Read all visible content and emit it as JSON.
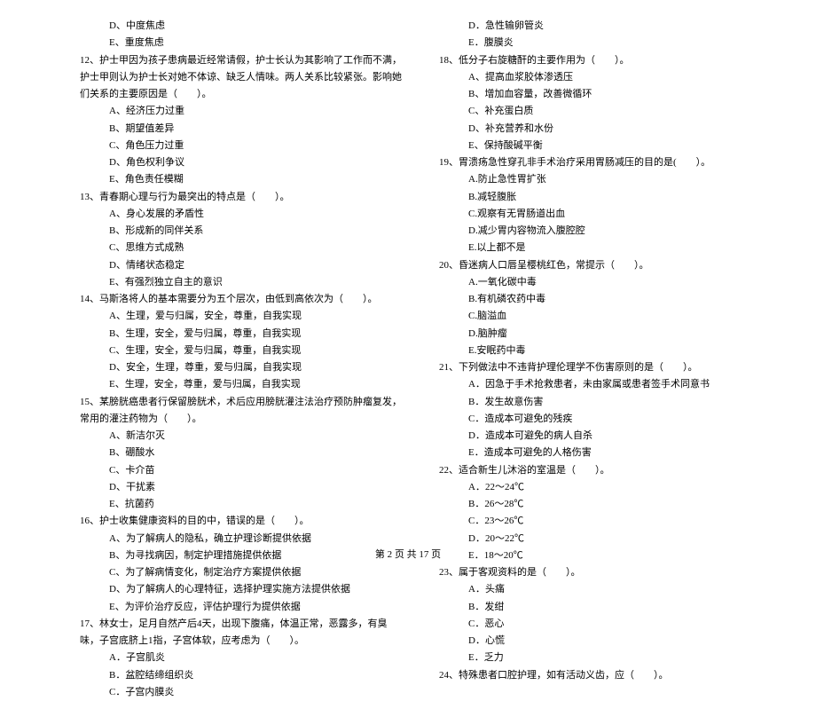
{
  "left": {
    "q11_opts": [
      "D、中度焦虑",
      "E、重度焦虑"
    ],
    "q12_stem": "12、护士甲因为孩子患病最近经常请假，护士长认为其影响了工作而不满，护士甲则认为护士长对她不体谅、缺乏人情味。两人关系比较紧张。影响她们关系的主要原因是（　　）。",
    "q12_opts": [
      "A、经济压力过重",
      "B、期望值差异",
      "C、角色压力过重",
      "D、角色权利争议",
      "E、角色责任模糊"
    ],
    "q13_stem": "13、青春期心理与行为最突出的特点是（　　）。",
    "q13_opts": [
      "A、身心发展的矛盾性",
      "B、形成新的同伴关系",
      "C、思维方式成熟",
      "D、情绪状态稳定",
      "E、有强烈独立自主的意识"
    ],
    "q14_stem": "14、马斯洛将人的基本需要分为五个层次，由低到高依次为（　　）。",
    "q14_opts": [
      "A、生理，爱与归属，安全，尊重，自我实现",
      "B、生理，安全，爱与归属，尊重，自我实现",
      "C、生理，安全，爱与归属，尊重，自我实现",
      "D、安全，生理，尊重，爱与归属，自我实现",
      "E、生理，安全，尊重，爱与归属，自我实现"
    ],
    "q15_stem": "15、某膀胱癌患者行保留膀胱术，术后应用膀胱灌注法治疗预防肿瘤复发，常用的灌注药物为（　　）。",
    "q15_opts": [
      "A、新洁尔灭",
      "B、硼酸水",
      "C、卡介苗",
      "D、干扰素",
      "E、抗菌药"
    ],
    "q16_stem": "16、护士收集健康资料的目的中，错误的是（　　）。",
    "q16_opts": [
      "A、为了解病人的隐私，确立护理诊断提供依据",
      "B、为寻找病因，制定护理措施提供依据",
      "C、为了解病情变化，制定治疗方案提供依据",
      "D、为了解病人的心理特征，选择护理实施方法提供依据",
      "E、为评价治疗反应，评估护理行为提供依据"
    ],
    "q17_stem": "17、林女士，足月自然产后4天，出现下腹痛，体温正常，恶露多，有臭味，子宫底脐上1指，子宫体软，应考虑为（　　）。",
    "q17_opts": [
      "A．子宫肌炎",
      "B．盆腔结缔组织炎",
      "C．子宫内膜炎"
    ]
  },
  "right": {
    "q17_opts2": [
      "D．急性输卵管炎",
      "E．腹膜炎"
    ],
    "q18_stem": "18、低分子右旋糖酐的主要作用为（　　）。",
    "q18_opts": [
      "A、提高血浆胶体渗透压",
      "B、增加血容量，改善微循环",
      "C、补充蛋白质",
      "D、补充营养和水份",
      "E、保持酸碱平衡"
    ],
    "q19_stem": "19、胃溃疡急性穿孔非手术治疗采用胃肠减压的目的是(　　）。",
    "q19_opts": [
      "A.防止急性胃扩张",
      "B.减轻腹胀",
      "C.观察有无胃肠道出血",
      "D.减少胃内容物流入腹腔腔",
      "E.以上都不是"
    ],
    "q20_stem": "20、昏迷病人口唇呈樱桃红色，常提示（　　）。",
    "q20_opts": [
      "A.一氧化碳中毒",
      "B.有机磷农药中毒",
      "C.脑溢血",
      "D.脑肿瘤",
      "E.安眠药中毒"
    ],
    "q21_stem": "21、下列做法中不违背护理伦理学不伤害原则的是（　　）。",
    "q21_opts": [
      "A．因急于手术抢救患者，未由家属或患者签手术同意书",
      "B．发生故意伤害",
      "C．造成本可避免的残疾",
      "D．造成本可避免的病人自杀",
      "E．造成本可避免的人格伤害"
    ],
    "q22_stem": "22、适合新生儿沐浴的室温是（　　）。",
    "q22_opts": [
      "A．22～24℃",
      "B．26～28℃",
      "C．23～26℃",
      "D．20～22℃",
      "E．18～20℃"
    ],
    "q23_stem": "23、属于客观资料的是（　　）。",
    "q23_opts": [
      "A．头痛",
      "B．发绀",
      "C．恶心",
      "D．心慌",
      "E．乏力"
    ],
    "q24_stem": "24、特殊患者口腔护理，如有活动义齿，应（　　）。"
  },
  "footer": "第 2 页 共 17 页"
}
